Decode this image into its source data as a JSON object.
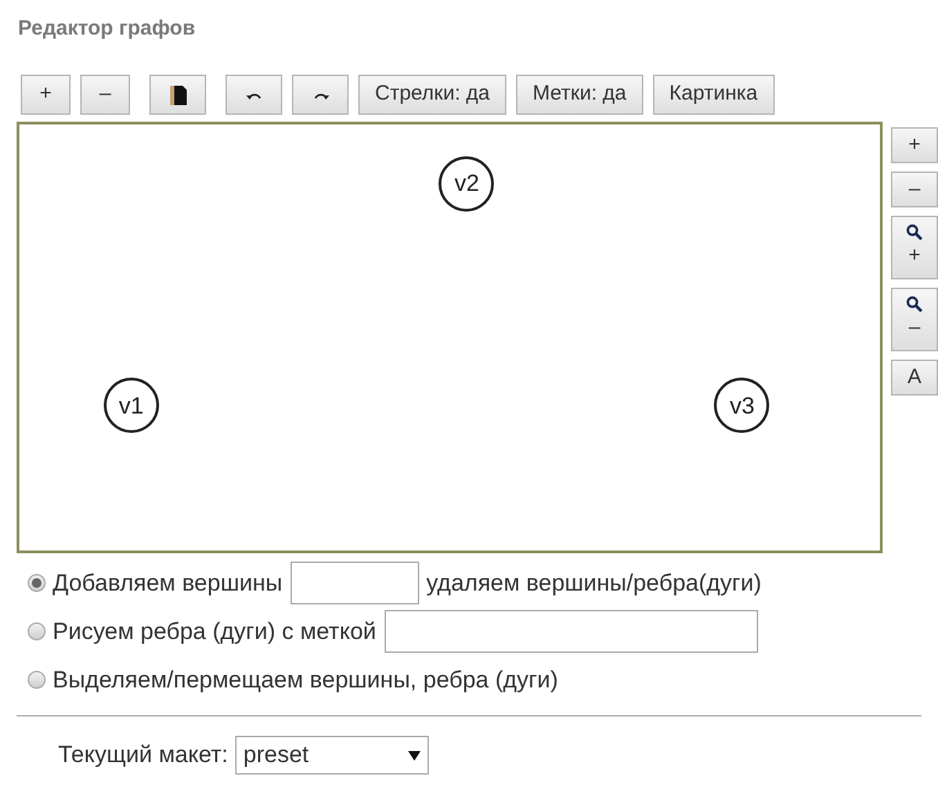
{
  "title": "Редактор графов",
  "toolbar": [
    {
      "kind": "text",
      "label": "+"
    },
    {
      "kind": "text",
      "label": "–"
    },
    {
      "kind": "save"
    },
    {
      "kind": "undo"
    },
    {
      "kind": "redo"
    },
    {
      "kind": "text",
      "label": "Стрелки: да"
    },
    {
      "kind": "text",
      "label": "Метки: да"
    },
    {
      "kind": "text",
      "label": "Картинка"
    }
  ],
  "canvas": {
    "vertices": [
      {
        "label": "v2"
      },
      {
        "label": "v1"
      },
      {
        "label": "v3"
      }
    ]
  },
  "side_buttons": [
    {
      "kind": "text",
      "label": "+"
    },
    {
      "kind": "text",
      "label": "–"
    },
    {
      "kind": "zoom",
      "label": "+"
    },
    {
      "kind": "zoom",
      "label": "–"
    },
    {
      "kind": "text",
      "label": "A"
    }
  ],
  "modes": [
    {
      "kind": "field_suffix",
      "label": "Добавляем вершины",
      "suffix": "удаляем вершины/ребра(дуги)",
      "selected": true
    },
    {
      "kind": "field",
      "label": "Рисуем ребра (дуги) с меткой",
      "selected": false
    },
    {
      "kind": "plain",
      "label": "Выделяем/пермещаем вершины, ребра (дуги)",
      "selected": false
    }
  ],
  "layout": {
    "label": "Текущий макет:",
    "value": "preset"
  }
}
